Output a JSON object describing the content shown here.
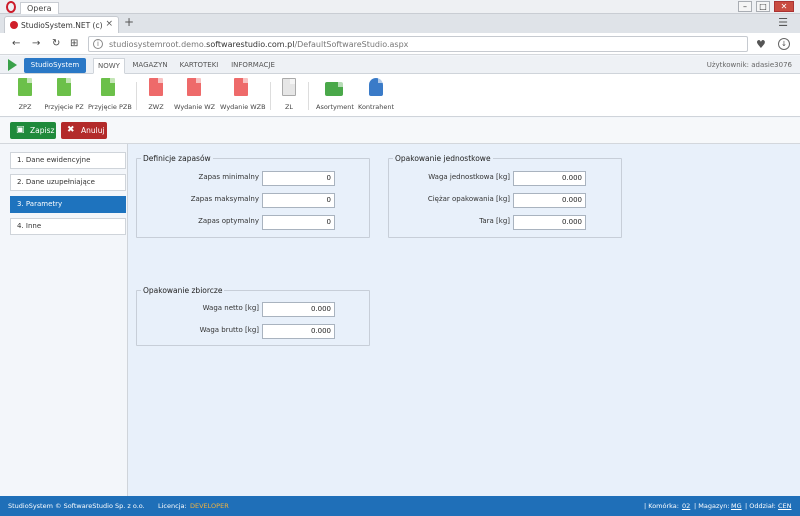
{
  "window": {
    "title": "Opera"
  },
  "browser": {
    "tab_label": "StudioSystem.NET (c) Soft",
    "tab_close": "×",
    "new_tab": "+",
    "url_domain": "studiosystemroot.demo.",
    "url_host": "softwarestudio.com.pl",
    "url_path": "/DefaultSoftwareStudio.aspx"
  },
  "app": {
    "brand_button": "StudioSystem",
    "menu_tabs": [
      "NOWY",
      "MAGAZYN",
      "KARTOTEKI",
      "INFORMACJE"
    ],
    "user": "Użytkownik: adasie3076"
  },
  "ribbon": [
    {
      "label": "ZPZ",
      "icon": "document-green-icon"
    },
    {
      "label": "Przyjęcie PZ",
      "icon": "document-green-icon"
    },
    {
      "label": "Przyjęcie PZB",
      "icon": "document-green-icon"
    },
    {
      "label": "ZWZ",
      "icon": "document-red-icon"
    },
    {
      "label": "Wydanie WZ",
      "icon": "document-red-icon"
    },
    {
      "label": "Wydanie WZB",
      "icon": "document-red-icon"
    },
    {
      "label": "ZL",
      "icon": "document-blank-icon"
    },
    {
      "label": "Asortyment",
      "icon": "boxes-icon"
    },
    {
      "label": "Kontrahent",
      "icon": "person-add-icon"
    }
  ],
  "actions": {
    "save": "Zapisz",
    "cancel": "Anuluj"
  },
  "left_nav": [
    {
      "label": "1. Dane ewidencyjne",
      "active": false
    },
    {
      "label": "2. Dane uzupełniające",
      "active": false
    },
    {
      "label": "3. Parametry",
      "active": true
    },
    {
      "label": "4. Inne",
      "active": false
    }
  ],
  "sections": {
    "stock": {
      "title": "Definicje zapasów",
      "rows": [
        {
          "label": "Zapas minimalny",
          "value": "0"
        },
        {
          "label": "Zapas maksymalny",
          "value": "0"
        },
        {
          "label": "Zapas optymalny",
          "value": "0"
        }
      ]
    },
    "unit_pack": {
      "title": "Opakowanie jednostkowe",
      "rows": [
        {
          "label": "Waga jednostkowa [kg]",
          "value": "0.000"
        },
        {
          "label": "Ciężar opakowania [kg]",
          "value": "0.000"
        },
        {
          "label": "Tara [kg]",
          "value": "0.000"
        }
      ]
    },
    "bulk_pack": {
      "title": "Opakowanie zbiorcze",
      "rows": [
        {
          "label": "Waga netto [kg]",
          "value": "0.000"
        },
        {
          "label": "Waga brutto [kg]",
          "value": "0.000"
        }
      ]
    }
  },
  "footer": {
    "copyright": "StudioSystem © SoftwareStudio Sp. z o.o.",
    "license_label": "Licencja:",
    "license_value": "DEVELOPER",
    "cell_label": "| Komórka:",
    "cell_value": "02",
    "warehouse_label": "| Magazyn:",
    "warehouse_value": "MG",
    "branch_label": "| Oddział:",
    "branch_value": "CEN"
  },
  "colors": {
    "accent": "#1e73be",
    "save": "#1f8a3b",
    "cancel": "#b32a2a",
    "license": "#f6b33a"
  }
}
